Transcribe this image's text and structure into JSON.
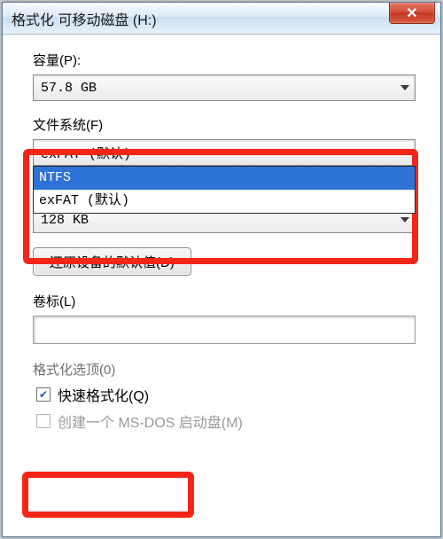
{
  "title": "格式化 可移动磁盘 (H:)",
  "capacity": {
    "label": "容量(P):",
    "value": "57.8 GB"
  },
  "filesystem": {
    "label": "文件系统(F)",
    "value": "exFAT (默认)",
    "options": [
      "NTFS",
      "exFAT (默认)"
    ]
  },
  "allocation": {
    "value": "128 KB"
  },
  "restore_btn": "还原设备的默认值(D)",
  "volume": {
    "label": "卷标(L)",
    "value": ""
  },
  "format_options_label": "格式化选顶(0)",
  "quick_format": {
    "label": "快速格式化(Q)",
    "checked": true
  },
  "msdos_boot": {
    "label": "创建一个 MS-DOS 启动盘(M)",
    "checked": false
  },
  "close_glyph": "✕"
}
